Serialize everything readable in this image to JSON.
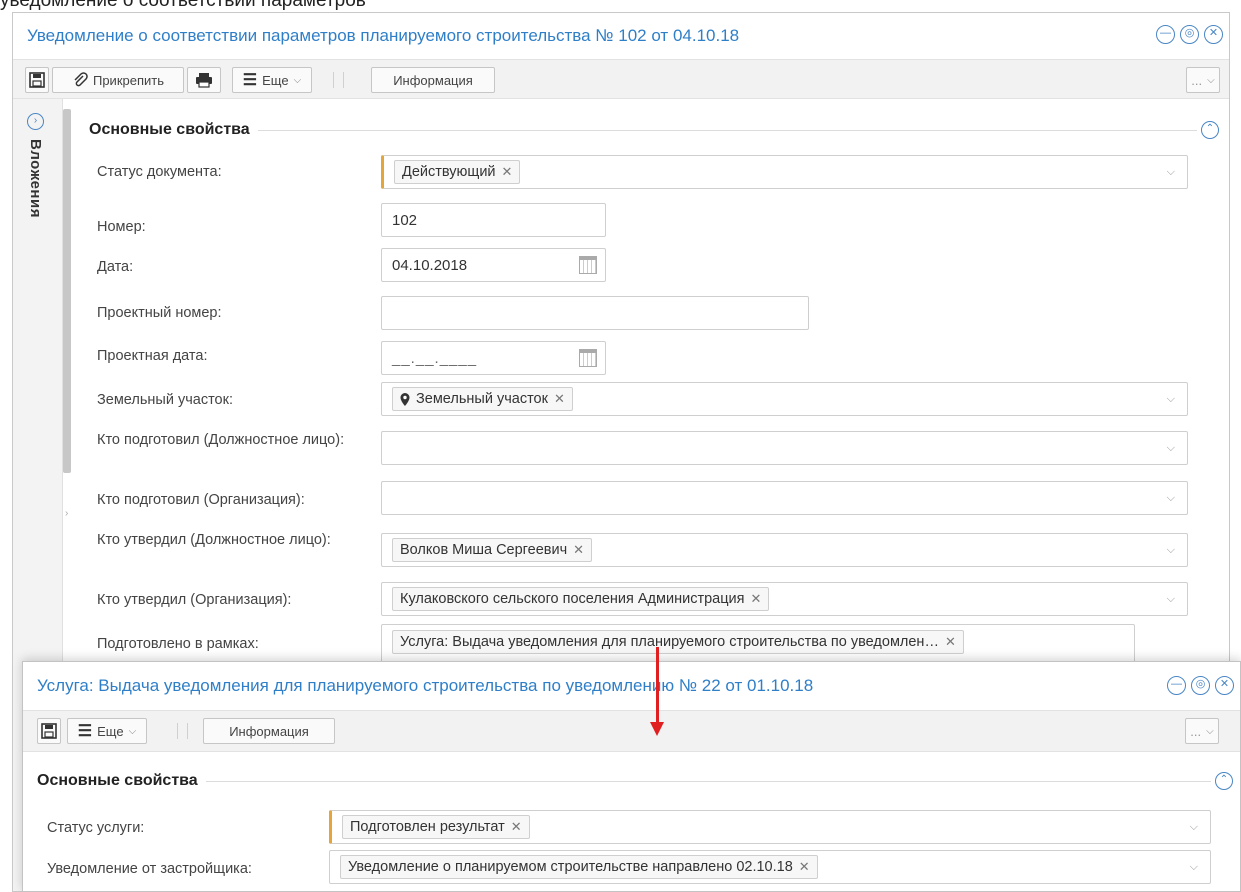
{
  "page": {
    "caption": "уведомление о соответствии параметров"
  },
  "main_dialog": {
    "title": "Уведомление о соответствии параметров планируемого строительства № 102 от 04.10.18",
    "toolbar": {
      "attach_label": "Прикрепить",
      "more_label": "Еще",
      "info_label": "Информация",
      "overflow_label": "..."
    },
    "side_panel_label": "Вложения",
    "section_title": "Основные свойства",
    "fields": {
      "status": {
        "label": "Статус документа:",
        "value": "Действующий"
      },
      "number": {
        "label": "Номер:",
        "value": "102"
      },
      "date": {
        "label": "Дата:",
        "value": "04.10.2018"
      },
      "project_number": {
        "label": "Проектный номер:",
        "value": ""
      },
      "project_date": {
        "label": "Проектная дата:",
        "placeholder": "__.__.____"
      },
      "land_plot": {
        "label": "Земельный участок:",
        "value": "Земельный участок"
      },
      "prepared_person": {
        "label": "Кто подготовил (Должностное лицо):",
        "value": ""
      },
      "prepared_org": {
        "label": "Кто подготовил (Организация):",
        "value": ""
      },
      "approved_person": {
        "label": "Кто утвердил (Должностное лицо):",
        "value": "Волков Миша Сергеевич"
      },
      "approved_org": {
        "label": "Кто утвердил (Организация):",
        "value": "Кулаковского сельского поселения Администрация"
      },
      "prepared_within": {
        "label": "Подготовлено в рамках:",
        "value": "Услуга: Выдача уведомления для планируемого строительства по уведомлен…"
      }
    }
  },
  "service_dialog": {
    "title": "Услуга: Выдача уведомления для планируемого строительства по уведомлению № 22 от 01.10.18",
    "toolbar": {
      "more_label": "Еще",
      "info_label": "Информация",
      "overflow_label": "..."
    },
    "section_title": "Основные свойства",
    "fields": {
      "service_status": {
        "label": "Статус услуги:",
        "value": "Подготовлен результат"
      },
      "developer_notice": {
        "label": "Уведомление от застройщика:",
        "value": "Уведомление о планируемом строительстве направлено 02.10.18"
      }
    }
  },
  "colors": {
    "accent_blue": "#2f7fc8",
    "required_marker": "#e4a63a",
    "annotation_arrow": "#e02020"
  }
}
